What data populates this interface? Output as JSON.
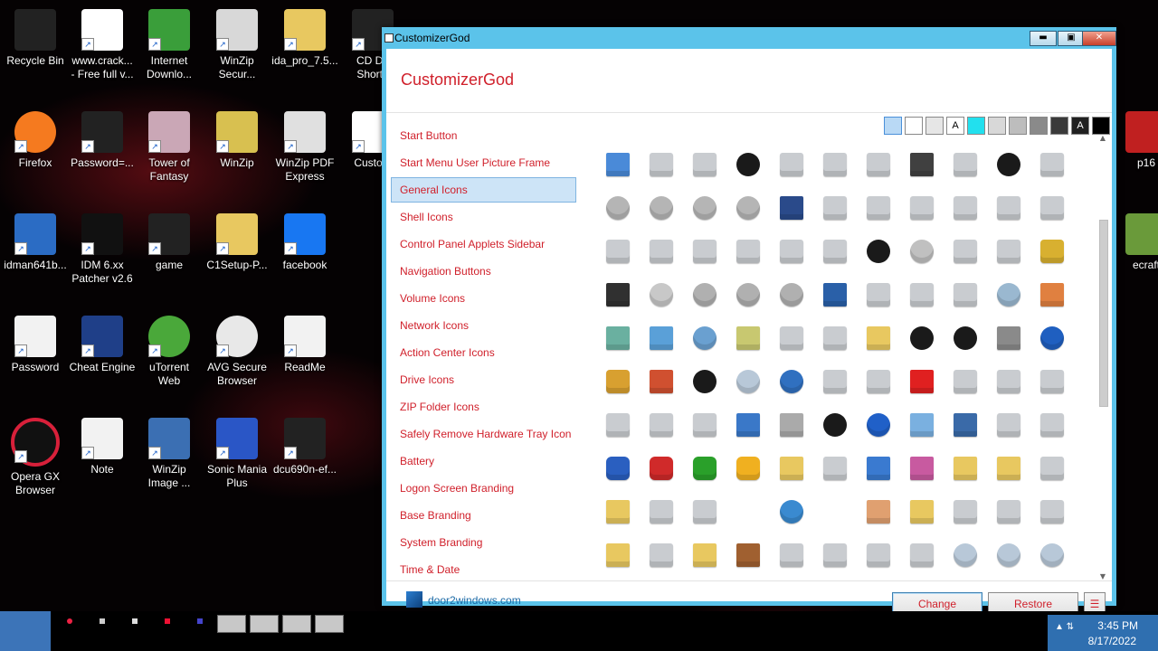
{
  "desktop": {
    "icons": [
      {
        "label": "Recycle Bin",
        "icon": "recycle-bin-icon"
      },
      {
        "label": "www.crack...\n- Free full v...",
        "icon": "firefox-shortcut-icon"
      },
      {
        "label": "Internet\nDownlo...",
        "icon": "internet-download-manager-icon"
      },
      {
        "label": "WinZip\nSecur...",
        "icon": "winzip-secure-icon"
      },
      {
        "label": "ida_pro_7.5...",
        "icon": "folder-icon"
      },
      {
        "label": "CD Dri\nShorto",
        "icon": "cd-drive-shortcut-icon"
      },
      {
        "label": "Firefox",
        "icon": "firefox-icon"
      },
      {
        "label": "Password=...",
        "icon": "password-icon"
      },
      {
        "label": "Tower of\nFantasy",
        "icon": "tower-of-fantasy-icon"
      },
      {
        "label": "WinZip",
        "icon": "winzip-icon"
      },
      {
        "label": "WinZip PDF\nExpress",
        "icon": "winzip-pdf-icon"
      },
      {
        "label": "Custom",
        "icon": "customizergod-icon"
      },
      {
        "label": "idman641b...",
        "icon": "idm-installer-icon"
      },
      {
        "label": "IDM 6.xx\nPatcher v2.6",
        "icon": "idm-patcher-icon"
      },
      {
        "label": "game",
        "icon": "game-icon"
      },
      {
        "label": "C1Setup-P...",
        "icon": "folder-icon"
      },
      {
        "label": "facebook",
        "icon": "facebook-icon"
      },
      {
        "label": "Password",
        "icon": "document-icon"
      },
      {
        "label": "Cheat Engine",
        "icon": "cheat-engine-icon"
      },
      {
        "label": "uTorrent\nWeb",
        "icon": "utorrent-icon"
      },
      {
        "label": "AVG Secure\nBrowser",
        "icon": "avg-browser-icon"
      },
      {
        "label": "ReadMe",
        "icon": "document-icon"
      },
      {
        "label": "Opera GX\nBrowser",
        "icon": "opera-gx-icon"
      },
      {
        "label": "Note",
        "icon": "document-icon"
      },
      {
        "label": "WinZip\nImage ...",
        "icon": "winzip-image-icon"
      },
      {
        "label": "Sonic Mania\nPlus",
        "icon": "sonic-icon"
      },
      {
        "label": "dcu690n-ef...",
        "icon": "dcu-icon"
      },
      {
        "label": "p16",
        "icon": "red-app-icon"
      },
      {
        "label": "ecraft",
        "icon": "minecraft-icon"
      }
    ]
  },
  "window": {
    "title": "CustomizerGod",
    "app_title": "CustomizerGod",
    "controls": {
      "minimize": "▬",
      "maximize": "▣",
      "close": "✕"
    },
    "nav": [
      "Start Button",
      "Start Menu User Picture Frame",
      "General Icons",
      "Shell Icons",
      "Control Panel Applets Sidebar",
      "Navigation Buttons",
      "Volume Icons",
      "Network Icons",
      "Action Center Icons",
      "Drive Icons",
      "ZIP Folder Icons",
      "Safely Remove Hardware Tray Icon",
      "Battery",
      "Logon Screen Branding",
      "Base Branding",
      "System Branding",
      "Time & Date"
    ],
    "selected_nav": "General Icons",
    "swatches": [
      {
        "color": "#b9d9f5",
        "text": ""
      },
      {
        "color": "#ffffff",
        "text": ""
      },
      {
        "color": "#e6e6e6",
        "text": ""
      },
      {
        "color": "#ffffff",
        "text": "A"
      },
      {
        "color": "#22e0ee",
        "text": ""
      },
      {
        "color": "#d8d8d8",
        "text": ""
      },
      {
        "color": "#bdbdbd",
        "text": ""
      },
      {
        "color": "#8a8a8a",
        "text": ""
      },
      {
        "color": "#3a3a3a",
        "text": ""
      },
      {
        "color": "#202020",
        "text": "A"
      },
      {
        "color": "#000000",
        "text": ""
      }
    ],
    "icon_grid": [
      [
        "control-panel",
        "floppy-drive",
        "removable-drive",
        "creature",
        "drive-error",
        "hard-drive",
        "network-drive",
        "memory-chip",
        "drive-flat",
        "creature",
        "dvd-drive"
      ],
      [
        "dvd-r",
        "dvd-ram",
        "dvd-rom",
        "dvd-rw",
        "tablet",
        "printer-drive",
        "scanner",
        "globe-printer",
        "camcorder",
        "phone",
        "floppy-check"
      ],
      [
        "printer-check",
        "printer-share",
        "printer",
        "fax",
        "printer-network",
        "recycle-bin",
        "creature",
        "dvd-disc",
        "camera",
        "mouse",
        "lock"
      ],
      [
        "media-card",
        "cd",
        "cd-r",
        "cd-rom",
        "cd-rw",
        "notepad",
        "remote",
        "settings-page",
        "settings-window",
        "settings-gear",
        "paint"
      ],
      [
        "image",
        "photo",
        "network-globe",
        "network-users",
        "network-drive-alt",
        "printer-alt",
        "fonts-folder",
        "creature",
        "creature",
        "server",
        "info"
      ],
      [
        "key",
        "certificate",
        "creature",
        "music-cd",
        "help-circle",
        "copy",
        "users",
        "delete",
        "text-doc",
        "keyboard",
        "screen"
      ],
      [
        "pda",
        "remote-desktop",
        "scanner-flat",
        "window",
        "x-mark",
        "creature",
        "help",
        "display-tile",
        "monitor",
        "blank-doc",
        "presentation"
      ],
      [
        "shield-help",
        "shield-error",
        "shield-check",
        "shield-warning",
        "music-folder",
        "computer",
        "desktop",
        "app-folder",
        "folder-doc",
        "folder-open",
        "gear-check"
      ],
      [
        "star-folder",
        "list",
        "clipboard",
        "blank",
        "internet",
        "blank",
        "paint-window",
        "person-folder",
        "font",
        "font-tt",
        "font-c"
      ],
      [
        "game-folder",
        "write",
        "fonts-folder",
        "briefcase",
        "music-note",
        "text-file",
        "video",
        "video-file",
        "cd-music",
        "cd-video",
        "cd-globe"
      ]
    ],
    "footer": {
      "link": "door2windows.com",
      "change": "Change",
      "restore": "Restore",
      "menu": "☰"
    }
  },
  "taskbar": {
    "time": "3:45 PM",
    "date": "8/17/2022",
    "tray_symbols": "▲ ⇅"
  },
  "colors": {
    "accent_red": "#d0202b",
    "window_frame": "#5bc3ea",
    "selection": "#cde4f7"
  }
}
